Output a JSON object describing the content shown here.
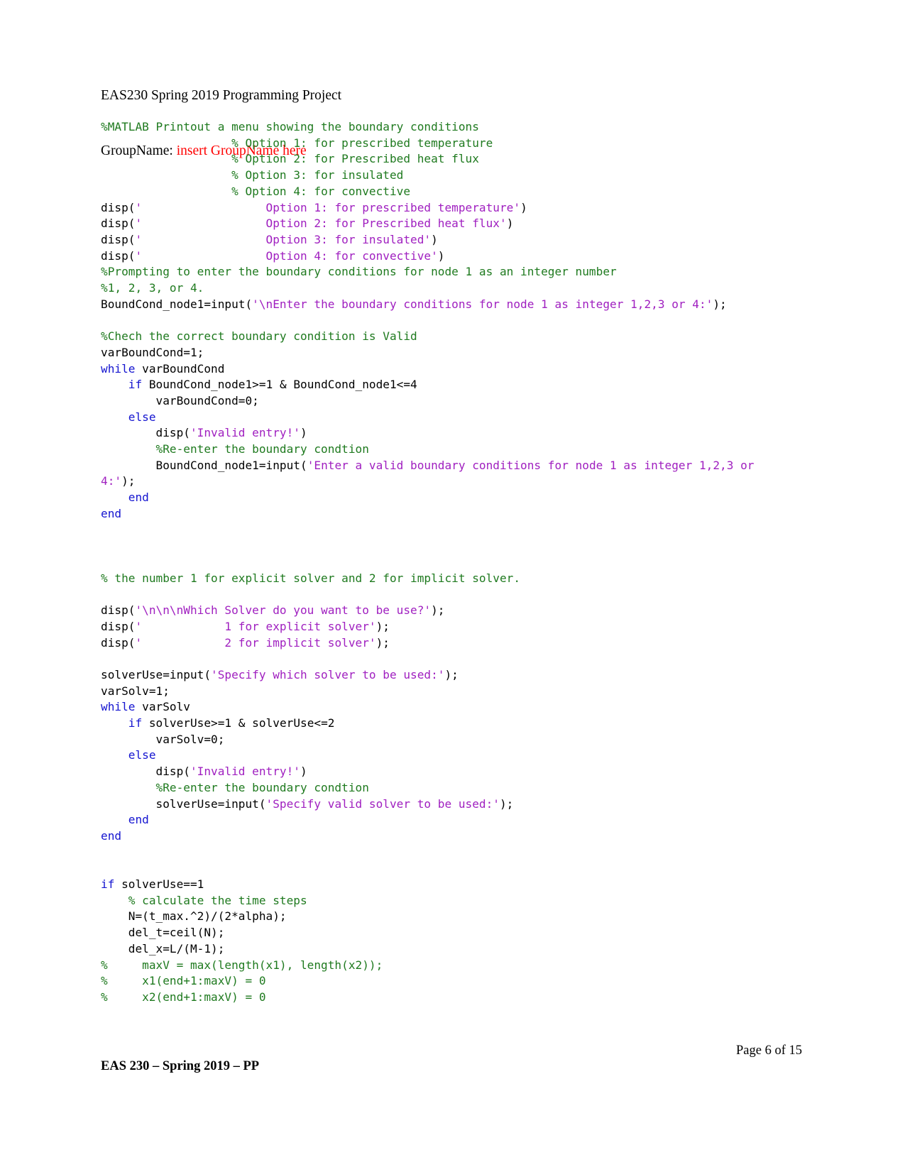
{
  "header": {
    "title": "EAS230 Spring 2019 Programming Project",
    "group_label": "GroupName: ",
    "group_placeholder": "insert GroupName here"
  },
  "colors": {
    "comment": "#1f7a1f",
    "string": "#a020c0",
    "keyword": "#1515d0",
    "identifier": "#000000",
    "placeholder_red": "#ff0000"
  },
  "code": {
    "language": "matlab",
    "lines": [
      {
        "segments": [
          {
            "t": "%MATLAB Printout a menu showing the boundary conditions",
            "c": "cm"
          }
        ]
      },
      {
        "segments": [
          {
            "t": "                   % Option 1: for prescribed temperature",
            "c": "cm"
          }
        ]
      },
      {
        "segments": [
          {
            "t": "                   % Option 2: for Prescribed heat flux",
            "c": "cm"
          }
        ]
      },
      {
        "segments": [
          {
            "t": "                   % Option 3: for insulated",
            "c": "cm"
          }
        ]
      },
      {
        "segments": [
          {
            "t": "                   % Option 4: for convective",
            "c": "cm"
          }
        ]
      },
      {
        "segments": [
          {
            "t": "disp(",
            "c": "id"
          },
          {
            "t": "'                  Option 1: for prescribed temperature'",
            "c": "str"
          },
          {
            "t": ")",
            "c": "id"
          }
        ]
      },
      {
        "segments": [
          {
            "t": "disp(",
            "c": "id"
          },
          {
            "t": "'                  Option 2: for Prescribed heat flux'",
            "c": "str"
          },
          {
            "t": ")",
            "c": "id"
          }
        ]
      },
      {
        "segments": [
          {
            "t": "disp(",
            "c": "id"
          },
          {
            "t": "'                  Option 3: for insulated'",
            "c": "str"
          },
          {
            "t": ")",
            "c": "id"
          }
        ]
      },
      {
        "segments": [
          {
            "t": "disp(",
            "c": "id"
          },
          {
            "t": "'                  Option 4: for convective'",
            "c": "str"
          },
          {
            "t": ")",
            "c": "id"
          }
        ]
      },
      {
        "segments": [
          {
            "t": "%Prompting to enter the boundary conditions for node 1 as an integer number",
            "c": "cm"
          }
        ]
      },
      {
        "segments": [
          {
            "t": "%1, 2, 3, or 4.",
            "c": "cm"
          }
        ]
      },
      {
        "segments": [
          {
            "t": "BoundCond_node1=input(",
            "c": "id"
          },
          {
            "t": "'\\nEnter the boundary conditions for node 1 as integer 1,2,3 or 4:'",
            "c": "str"
          },
          {
            "t": ");",
            "c": "id"
          }
        ]
      },
      {
        "segments": [
          {
            "t": "",
            "c": "id"
          }
        ]
      },
      {
        "segments": [
          {
            "t": "%Chech the correct boundary condition is Valid",
            "c": "cm"
          }
        ]
      },
      {
        "segments": [
          {
            "t": "varBoundCond=1;",
            "c": "id"
          }
        ]
      },
      {
        "segments": [
          {
            "t": "while",
            "c": "kw"
          },
          {
            "t": " varBoundCond",
            "c": "id"
          }
        ]
      },
      {
        "segments": [
          {
            "t": "    ",
            "c": "id"
          },
          {
            "t": "if",
            "c": "kw"
          },
          {
            "t": " BoundCond_node1>=1 & BoundCond_node1<=4",
            "c": "id"
          }
        ]
      },
      {
        "segments": [
          {
            "t": "        varBoundCond=0;",
            "c": "id"
          }
        ]
      },
      {
        "segments": [
          {
            "t": "    ",
            "c": "id"
          },
          {
            "t": "else",
            "c": "kw"
          }
        ]
      },
      {
        "segments": [
          {
            "t": "        disp(",
            "c": "id"
          },
          {
            "t": "'Invalid entry!'",
            "c": "str"
          },
          {
            "t": ")",
            "c": "id"
          }
        ]
      },
      {
        "segments": [
          {
            "t": "        ",
            "c": "id"
          },
          {
            "t": "%Re-enter the boundary condtion",
            "c": "cm"
          }
        ]
      },
      {
        "segments": [
          {
            "t": "        BoundCond_node1=input(",
            "c": "id"
          },
          {
            "t": "'Enter a valid boundary conditions for node 1 as integer 1,2,3 or 4:'",
            "c": "str"
          },
          {
            "t": ");",
            "c": "id"
          }
        ]
      },
      {
        "segments": [
          {
            "t": "    ",
            "c": "id"
          },
          {
            "t": "end",
            "c": "kw"
          }
        ]
      },
      {
        "segments": [
          {
            "t": "end",
            "c": "kw"
          }
        ]
      },
      {
        "segments": [
          {
            "t": "",
            "c": "id"
          }
        ]
      },
      {
        "segments": [
          {
            "t": "",
            "c": "id"
          }
        ]
      },
      {
        "segments": [
          {
            "t": "",
            "c": "id"
          }
        ]
      },
      {
        "segments": [
          {
            "t": "% the number 1 for explicit solver and 2 for implicit solver.",
            "c": "cm"
          }
        ]
      },
      {
        "segments": [
          {
            "t": "",
            "c": "id"
          }
        ]
      },
      {
        "segments": [
          {
            "t": "disp(",
            "c": "id"
          },
          {
            "t": "'\\n\\n\\nWhich Solver do you want to be use?'",
            "c": "str"
          },
          {
            "t": ");",
            "c": "id"
          }
        ]
      },
      {
        "segments": [
          {
            "t": "disp(",
            "c": "id"
          },
          {
            "t": "'            1 for explicit solver'",
            "c": "str"
          },
          {
            "t": ");",
            "c": "id"
          }
        ]
      },
      {
        "segments": [
          {
            "t": "disp(",
            "c": "id"
          },
          {
            "t": "'            2 for implicit solver'",
            "c": "str"
          },
          {
            "t": ");",
            "c": "id"
          }
        ]
      },
      {
        "segments": [
          {
            "t": "",
            "c": "id"
          }
        ]
      },
      {
        "segments": [
          {
            "t": "solverUse=input(",
            "c": "id"
          },
          {
            "t": "'Specify which solver to be used:'",
            "c": "str"
          },
          {
            "t": ");",
            "c": "id"
          }
        ]
      },
      {
        "segments": [
          {
            "t": "varSolv=1;",
            "c": "id"
          }
        ]
      },
      {
        "segments": [
          {
            "t": "while",
            "c": "kw"
          },
          {
            "t": " varSolv",
            "c": "id"
          }
        ]
      },
      {
        "segments": [
          {
            "t": "    ",
            "c": "id"
          },
          {
            "t": "if",
            "c": "kw"
          },
          {
            "t": " solverUse>=1 & solverUse<=2",
            "c": "id"
          }
        ]
      },
      {
        "segments": [
          {
            "t": "        varSolv=0;",
            "c": "id"
          }
        ]
      },
      {
        "segments": [
          {
            "t": "    ",
            "c": "id"
          },
          {
            "t": "else",
            "c": "kw"
          }
        ]
      },
      {
        "segments": [
          {
            "t": "        disp(",
            "c": "id"
          },
          {
            "t": "'Invalid entry!'",
            "c": "str"
          },
          {
            "t": ")",
            "c": "id"
          }
        ]
      },
      {
        "segments": [
          {
            "t": "        ",
            "c": "id"
          },
          {
            "t": "%Re-enter the boundary condtion",
            "c": "cm"
          }
        ]
      },
      {
        "segments": [
          {
            "t": "        solverUse=input(",
            "c": "id"
          },
          {
            "t": "'Specify valid solver to be used:'",
            "c": "str"
          },
          {
            "t": ");",
            "c": "id"
          }
        ]
      },
      {
        "segments": [
          {
            "t": "    ",
            "c": "id"
          },
          {
            "t": "end",
            "c": "kw"
          }
        ]
      },
      {
        "segments": [
          {
            "t": "end",
            "c": "kw"
          }
        ]
      },
      {
        "segments": [
          {
            "t": "",
            "c": "id"
          }
        ]
      },
      {
        "segments": [
          {
            "t": "",
            "c": "id"
          }
        ]
      },
      {
        "segments": [
          {
            "t": "if",
            "c": "kw"
          },
          {
            "t": " solverUse==1",
            "c": "id"
          }
        ]
      },
      {
        "segments": [
          {
            "t": "    ",
            "c": "id"
          },
          {
            "t": "% calculate the time steps",
            "c": "cm"
          }
        ]
      },
      {
        "segments": [
          {
            "t": "    N=(t_max.^2)/(2*alpha);",
            "c": "id"
          }
        ]
      },
      {
        "segments": [
          {
            "t": "    del_t=ceil(N);",
            "c": "id"
          }
        ]
      },
      {
        "segments": [
          {
            "t": "    del_x=L/(M-1);",
            "c": "id"
          }
        ]
      },
      {
        "segments": [
          {
            "t": "%     maxV = max(length(x1), length(x2));",
            "c": "cm"
          }
        ]
      },
      {
        "segments": [
          {
            "t": "%     x1(end+1:maxV) = 0",
            "c": "cm"
          }
        ]
      },
      {
        "segments": [
          {
            "t": "%     x2(end+1:maxV) = 0",
            "c": "cm"
          }
        ]
      }
    ]
  },
  "footer": {
    "page_number": "Page 6 of 15",
    "course": "EAS 230 – Spring 2019 – PP"
  }
}
